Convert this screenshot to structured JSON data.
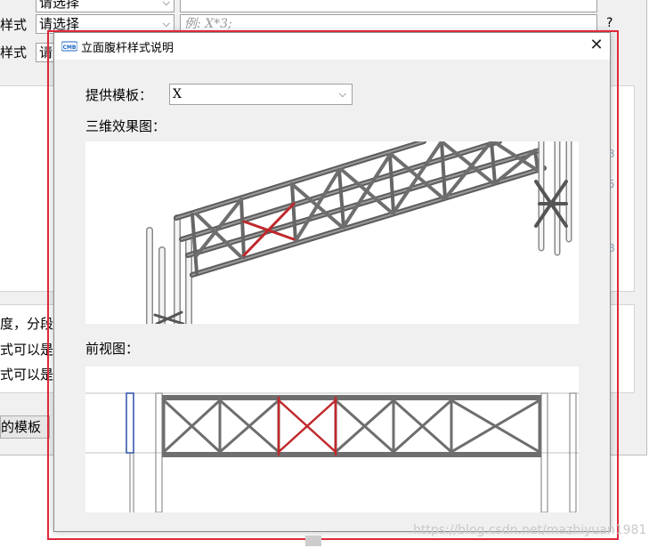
{
  "background": {
    "row1": {
      "label": "",
      "select_value": "请选择",
      "input_value": ""
    },
    "row2": {
      "label": "样式",
      "select_value": "请选择",
      "input_placeholder": "例: X*3;",
      "help": "?"
    },
    "row3": {
      "label": "样式",
      "select_value": "请"
    },
    "lines": [
      "度，分段",
      "式可以是",
      "式可以是"
    ],
    "template_button": "的模板",
    "side_glyphs": [
      "3",
      "5",
      "8"
    ]
  },
  "dialog": {
    "title": "立面腹杆样式说明",
    "close": "✕",
    "template_label": "提供模板：",
    "template_value": "X",
    "view3d_label": "三维效果图：",
    "front_label": "前视图："
  },
  "watermark": "https://blog.csdn.net/mazhiyuan1981",
  "colors": {
    "accent_red": "#e0273a",
    "member_gray": "#6e6e6e",
    "highlight_red": "#c0282b",
    "post_blue": "#2b4fa8"
  }
}
